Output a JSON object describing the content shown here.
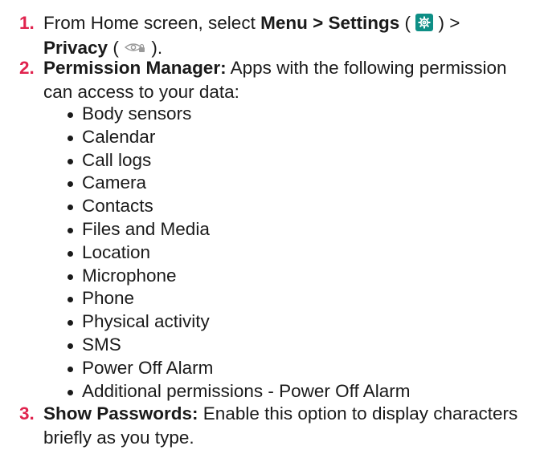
{
  "steps": [
    {
      "number": "1.",
      "text_a": "From Home screen, select ",
      "bold_a": "Menu > Settings",
      "text_b": " ( ",
      "icon_a": "settings-gear-icon",
      "text_c": " ) >",
      "bold_b": "Privacy",
      "text_d": " ( ",
      "icon_b": "privacy-eye-lock-icon",
      "text_e": " )."
    },
    {
      "number": "2.",
      "bold": "Permission Manager:",
      "text": " Apps with the following permission can access to your data:"
    },
    {
      "number": "3.",
      "bold": "Show Passwords:",
      "text": " Enable this option to display characters briefly as you type."
    }
  ],
  "permissions": [
    "Body sensors",
    "Calendar",
    "Call logs",
    "Camera",
    "Contacts",
    "Files and Media",
    "Location",
    "Microphone",
    "Phone",
    "Physical activity",
    "SMS",
    "Power Off Alarm",
    "Additional permissions - Power Off Alarm"
  ],
  "colors": {
    "step_number": "#e0234e",
    "settings_icon_bg": "#0e8f86",
    "text": "#1a1a1a"
  }
}
